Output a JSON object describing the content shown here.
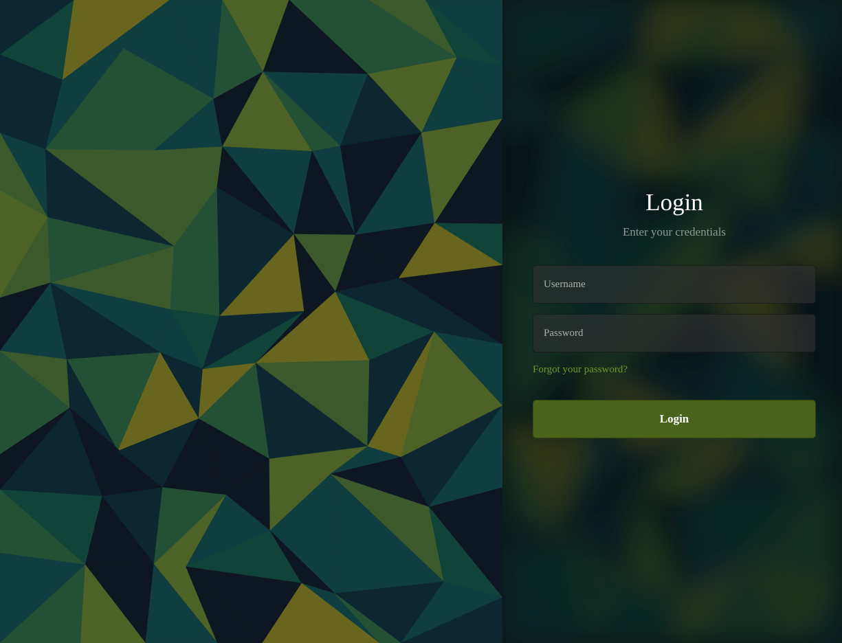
{
  "login": {
    "title": "Login",
    "subtitle": "Enter your credentials",
    "username_placeholder": "Username",
    "password_placeholder": "Password",
    "forgot_label": "Forgot your password?",
    "submit_label": "Login"
  },
  "colors": {
    "accent": "#4b621a",
    "link": "#6d9a2c",
    "background_dark": "#0e1621",
    "palette": [
      "#0e1621",
      "#0d2731",
      "#103d3f",
      "#114339",
      "#245035",
      "#3b5a2c",
      "#4d6226",
      "#68661e"
    ]
  }
}
